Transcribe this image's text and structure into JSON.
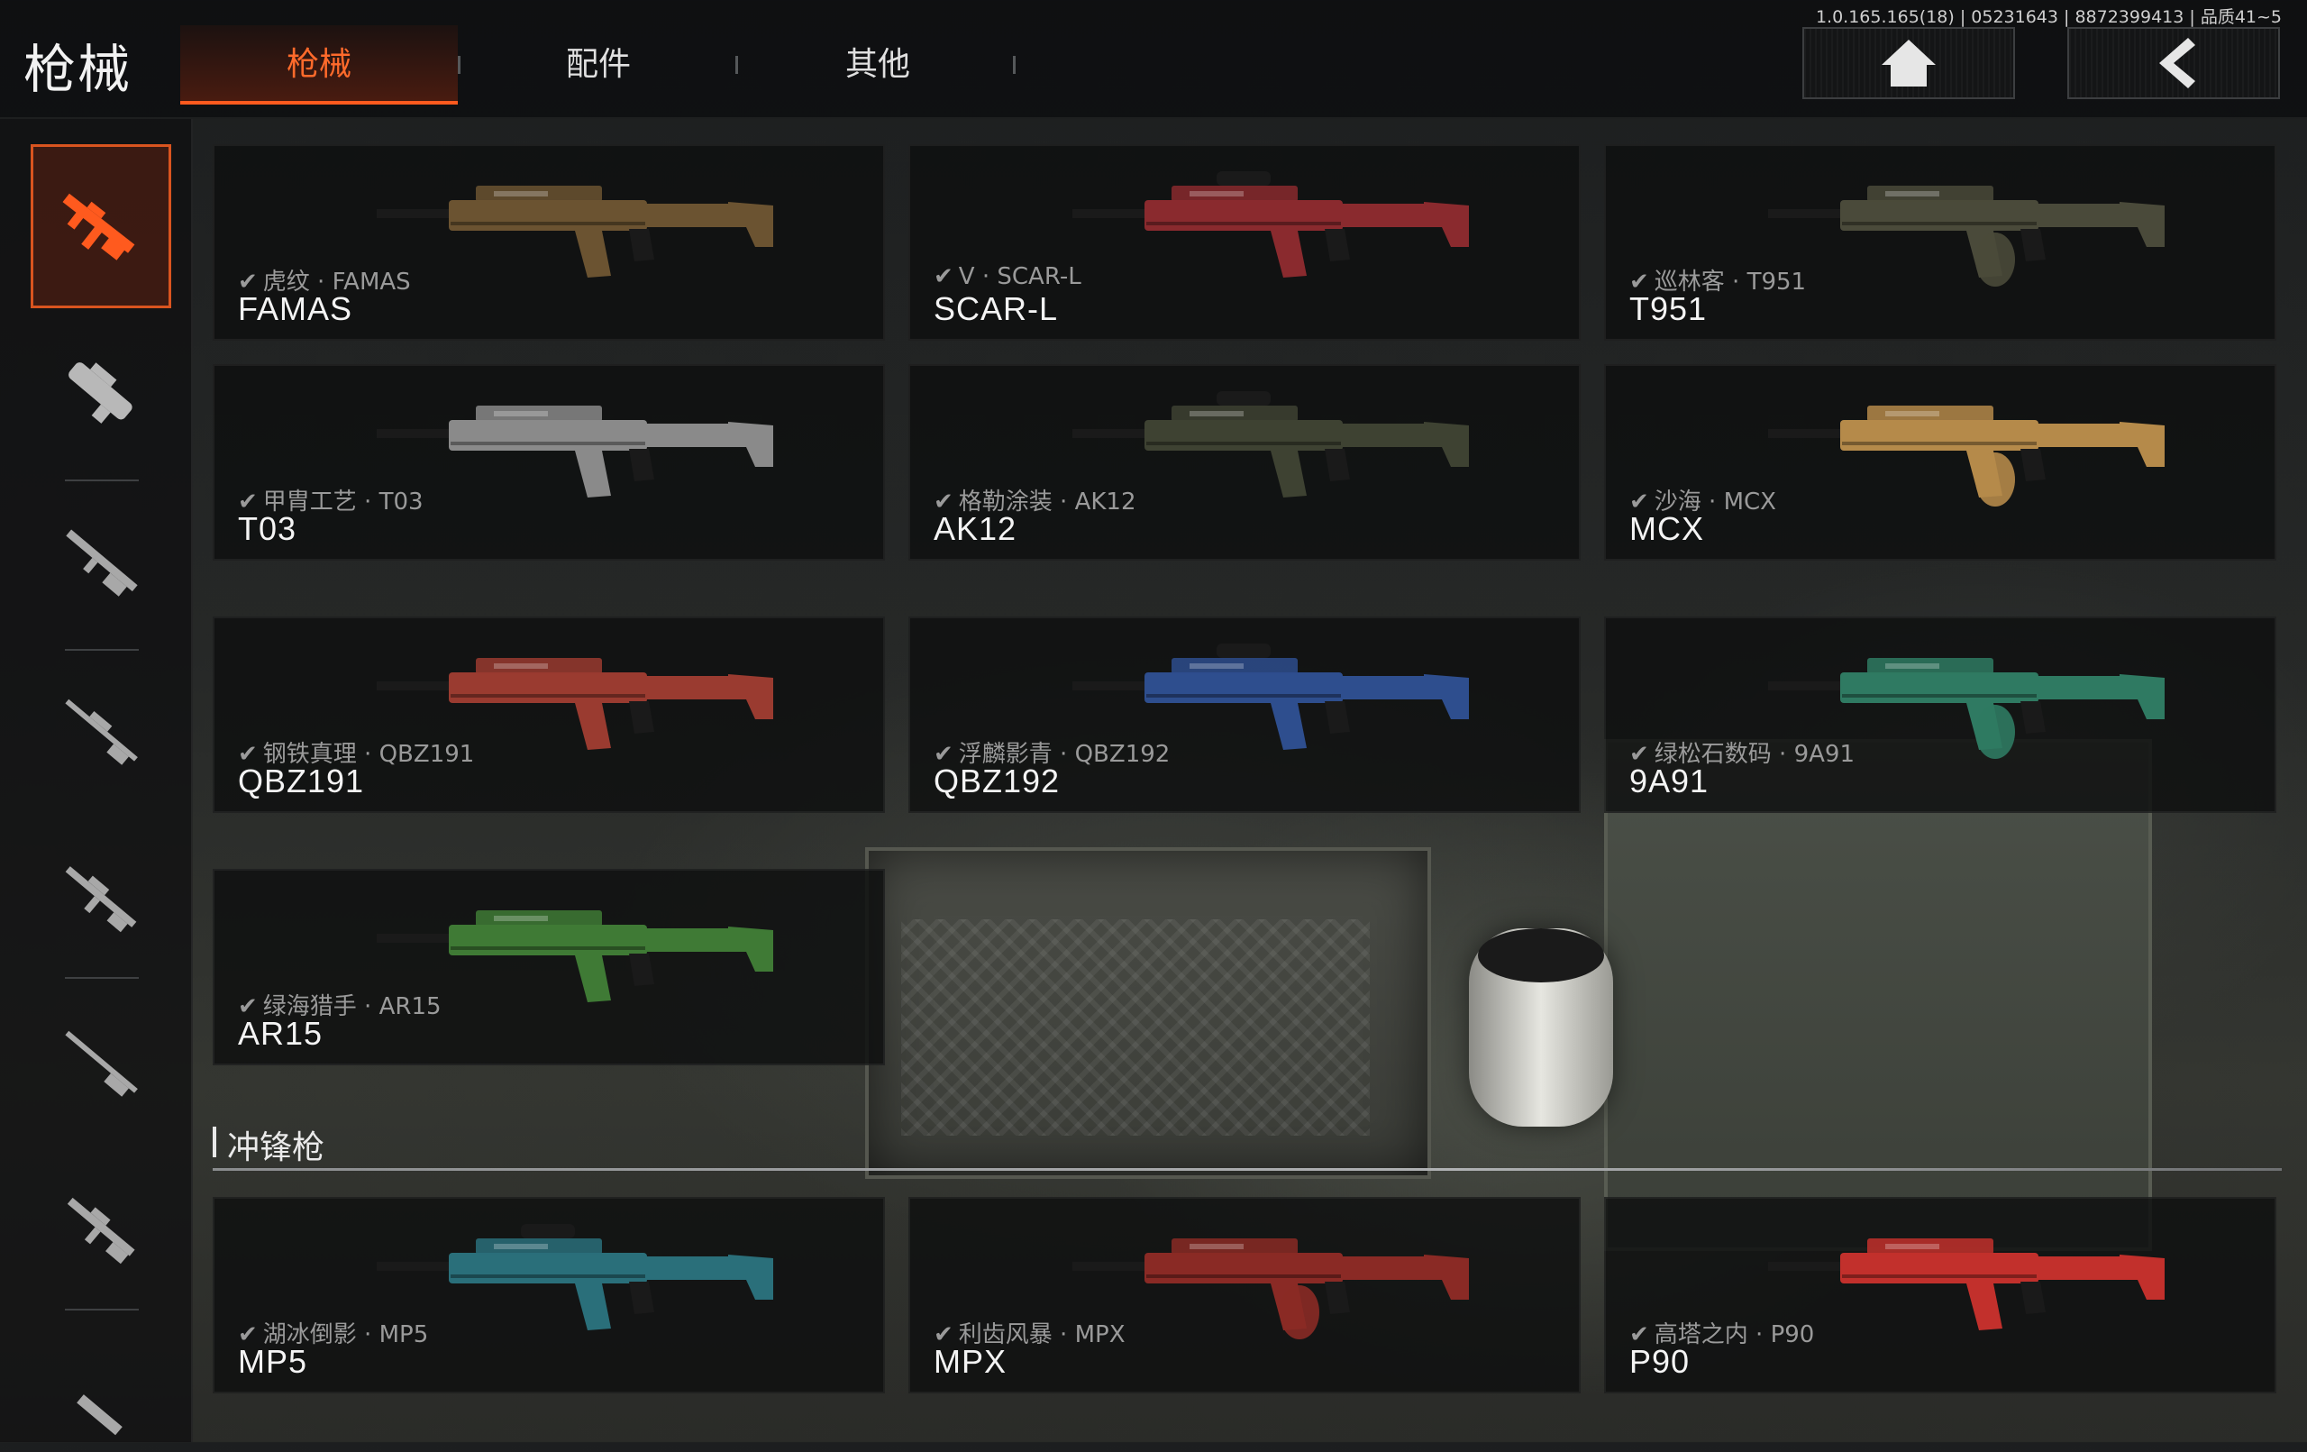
{
  "header": {
    "page_title": "枪械",
    "tabs": [
      {
        "label": "枪械",
        "active": true
      },
      {
        "label": "配件",
        "active": false
      },
      {
        "label": "其他",
        "active": false
      }
    ],
    "version_info": "1.0.165.165(18) | 05231643 | 8872399413 | 品质41~5",
    "home_icon": "home-icon",
    "back_icon": "chevron-left-icon"
  },
  "sidebar": {
    "categories": [
      {
        "icon": "assault-rifle-icon",
        "active": true
      },
      {
        "icon": "smg-icon",
        "active": false
      },
      {
        "icon": "shotgun-icon",
        "active": false
      },
      {
        "icon": "sniper-rifle-icon",
        "active": false
      },
      {
        "icon": "marksman-rifle-icon",
        "active": false
      },
      {
        "icon": "bolt-rifle-icon",
        "active": false
      },
      {
        "icon": "carbine-icon",
        "active": false
      },
      {
        "icon": "pistol-icon",
        "active": false
      }
    ]
  },
  "weapons": [
    {
      "skin": "虎纹 · FAMAS",
      "name": "FAMAS",
      "color": "#6b5331"
    },
    {
      "skin": "V · SCAR-L",
      "name": "SCAR-L",
      "color": "#8a2a2e"
    },
    {
      "skin": "巡林客 · T951",
      "name": "T951",
      "color": "#4a4a3a"
    },
    {
      "skin": "甲胄工艺 · T03",
      "name": "T03",
      "color": "#8a8a8a"
    },
    {
      "skin": "格勒涂装 · AK12",
      "name": "AK12",
      "color": "#3e4232"
    },
    {
      "skin": "沙海 · MCX",
      "name": "MCX",
      "color": "#b58a4a"
    },
    {
      "skin": "钢铁真理 · QBZ191",
      "name": "QBZ191",
      "color": "#9a3b30"
    },
    {
      "skin": "浮麟影青 · QBZ192",
      "name": "QBZ192",
      "color": "#2e4e8e"
    },
    {
      "skin": "绿松石数码 · 9A91",
      "name": "9A91",
      "color": "#2f7a62"
    },
    {
      "skin": "绿海猎手 · AR15",
      "name": "AR15",
      "color": "#3f7a35"
    }
  ],
  "smg_section": {
    "title": "冲锋枪",
    "weapons": [
      {
        "skin": "湖冰倒影 · MP5",
        "name": "MP5",
        "color": "#2a6f7a"
      },
      {
        "skin": "利齿风暴 · MPX",
        "name": "MPX",
        "color": "#8a2a25"
      },
      {
        "skin": "高塔之内 · P90",
        "name": "P90",
        "color": "#c2302c"
      }
    ]
  },
  "colors": {
    "accent": "#ff5a1e",
    "card_bg": "#0e0f10"
  }
}
